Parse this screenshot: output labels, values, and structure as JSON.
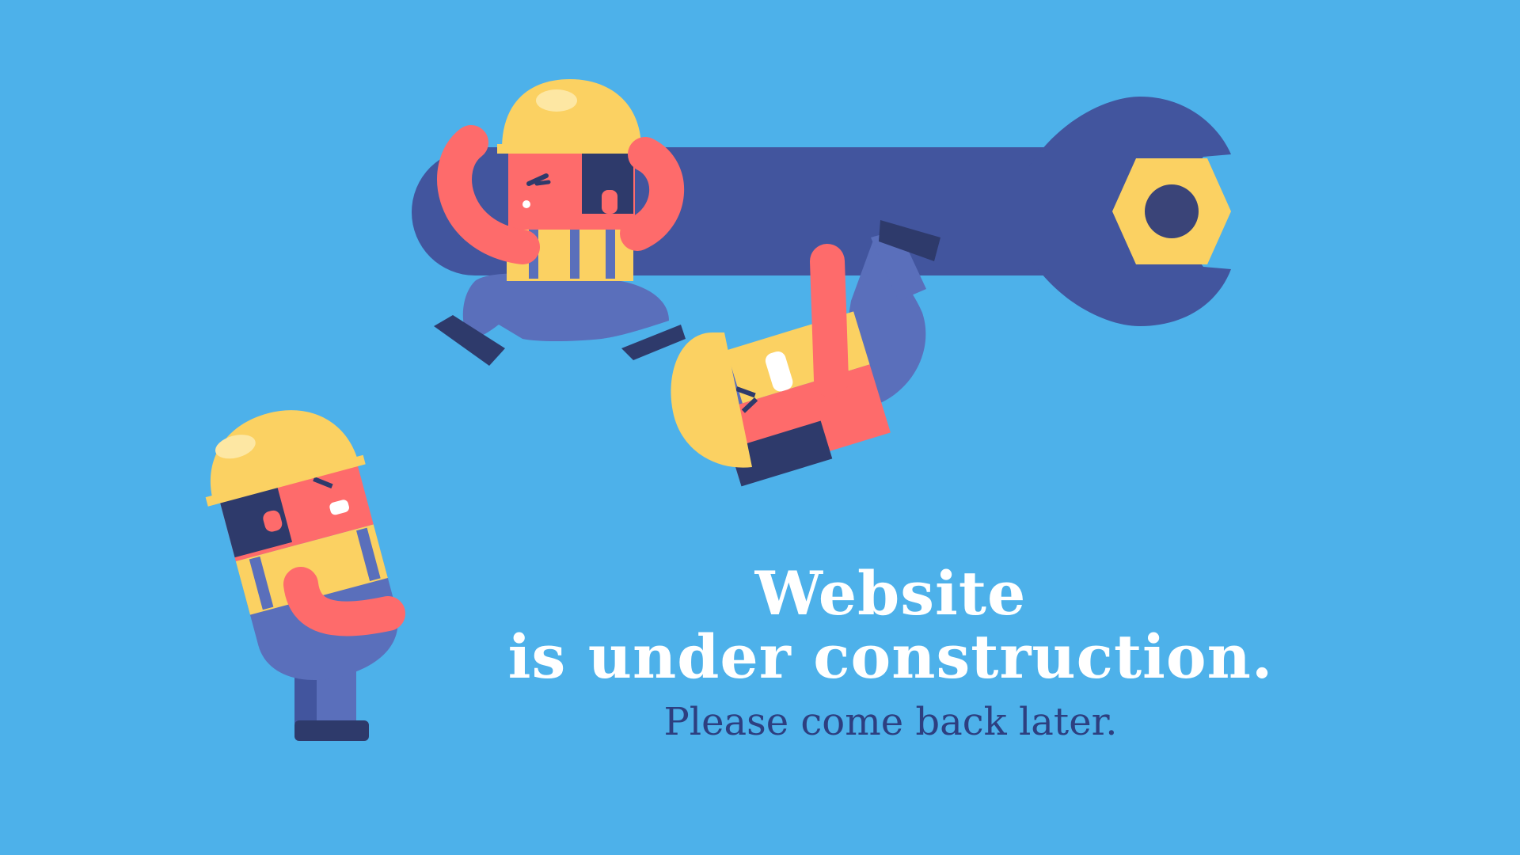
{
  "page": {
    "background_color": "#4db1ea"
  },
  "message": {
    "headline_line1": "Website",
    "headline_line2": "is under construction.",
    "subtitle": "Please come back later.",
    "headline_color": "#ffffff",
    "subtitle_color": "#2d3f80"
  },
  "illustration": {
    "wrench_color": "#42559e",
    "nut_color": "#fbd162",
    "helmet_color": "#fbd162",
    "skin_color": "#fe6b6b",
    "pants_color": "#5a6fbb",
    "dark_color": "#2e3a6b",
    "icons": [
      "wrench-icon",
      "hex-nut-icon",
      "construction-worker-icon"
    ]
  }
}
